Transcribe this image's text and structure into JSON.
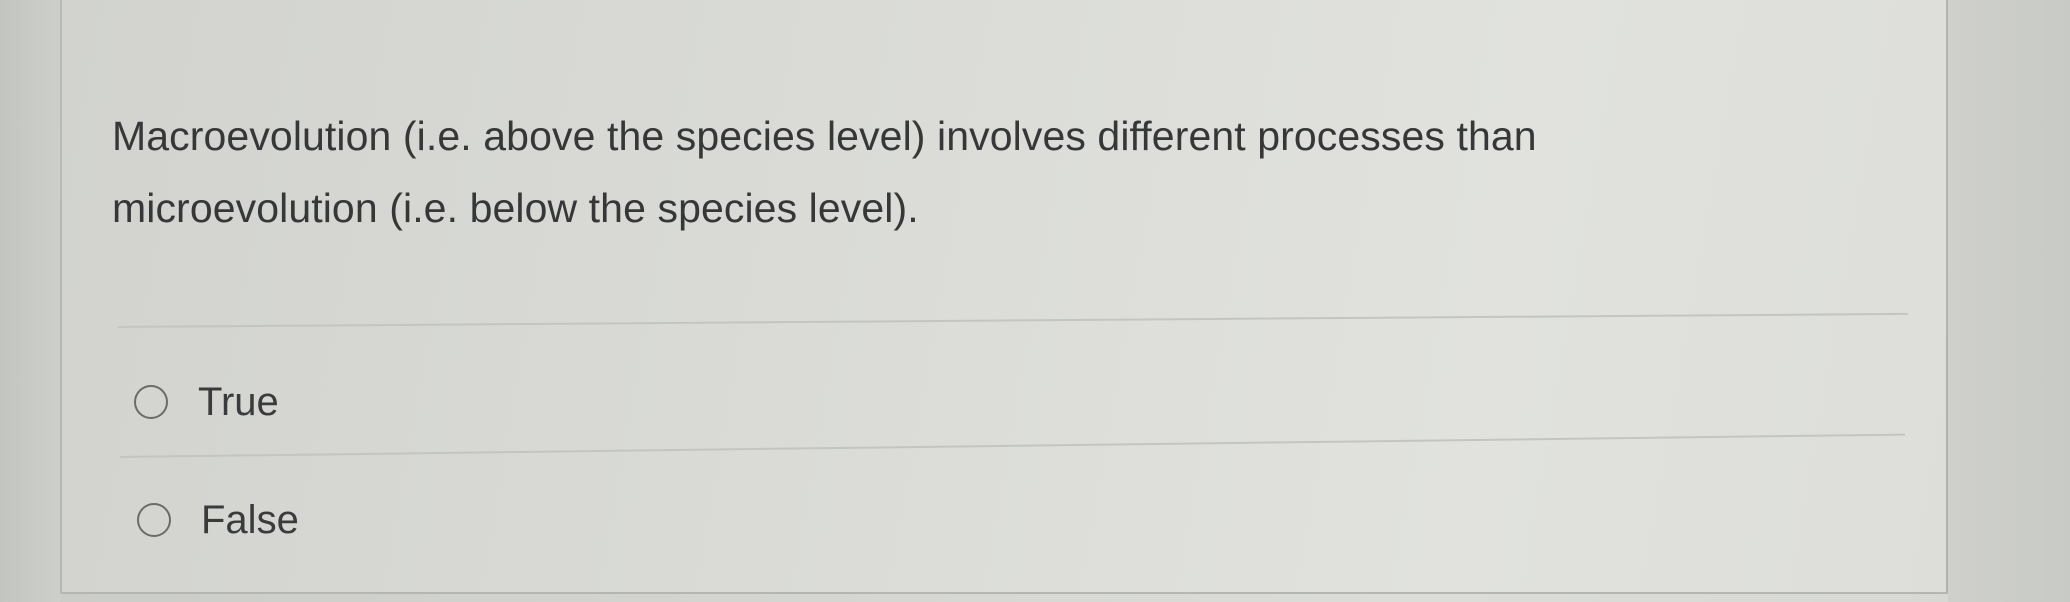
{
  "question": {
    "text": "Macroevolution (i.e. above the species level) involves different processes than microevolution (i.e. below the species level)."
  },
  "options": [
    {
      "label": "True",
      "selected": false
    },
    {
      "label": "False",
      "selected": false
    }
  ],
  "colors": {
    "background": "#d8d9d5",
    "text": "#363838",
    "divider": "#c3c5c0",
    "radio_border": "#6a6c6a"
  }
}
